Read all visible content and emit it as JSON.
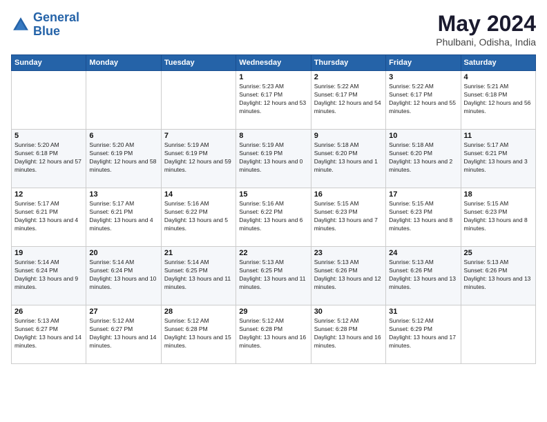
{
  "logo": {
    "line1": "General",
    "line2": "Blue"
  },
  "title": "May 2024",
  "location": "Phulbani, Odisha, India",
  "days_of_week": [
    "Sunday",
    "Monday",
    "Tuesday",
    "Wednesday",
    "Thursday",
    "Friday",
    "Saturday"
  ],
  "weeks": [
    [
      {
        "day": "",
        "sunrise": "",
        "sunset": "",
        "daylight": ""
      },
      {
        "day": "",
        "sunrise": "",
        "sunset": "",
        "daylight": ""
      },
      {
        "day": "",
        "sunrise": "",
        "sunset": "",
        "daylight": ""
      },
      {
        "day": "1",
        "sunrise": "Sunrise: 5:23 AM",
        "sunset": "Sunset: 6:17 PM",
        "daylight": "Daylight: 12 hours and 53 minutes."
      },
      {
        "day": "2",
        "sunrise": "Sunrise: 5:22 AM",
        "sunset": "Sunset: 6:17 PM",
        "daylight": "Daylight: 12 hours and 54 minutes."
      },
      {
        "day": "3",
        "sunrise": "Sunrise: 5:22 AM",
        "sunset": "Sunset: 6:17 PM",
        "daylight": "Daylight: 12 hours and 55 minutes."
      },
      {
        "day": "4",
        "sunrise": "Sunrise: 5:21 AM",
        "sunset": "Sunset: 6:18 PM",
        "daylight": "Daylight: 12 hours and 56 minutes."
      }
    ],
    [
      {
        "day": "5",
        "sunrise": "Sunrise: 5:20 AM",
        "sunset": "Sunset: 6:18 PM",
        "daylight": "Daylight: 12 hours and 57 minutes."
      },
      {
        "day": "6",
        "sunrise": "Sunrise: 5:20 AM",
        "sunset": "Sunset: 6:19 PM",
        "daylight": "Daylight: 12 hours and 58 minutes."
      },
      {
        "day": "7",
        "sunrise": "Sunrise: 5:19 AM",
        "sunset": "Sunset: 6:19 PM",
        "daylight": "Daylight: 12 hours and 59 minutes."
      },
      {
        "day": "8",
        "sunrise": "Sunrise: 5:19 AM",
        "sunset": "Sunset: 6:19 PM",
        "daylight": "Daylight: 13 hours and 0 minutes."
      },
      {
        "day": "9",
        "sunrise": "Sunrise: 5:18 AM",
        "sunset": "Sunset: 6:20 PM",
        "daylight": "Daylight: 13 hours and 1 minute."
      },
      {
        "day": "10",
        "sunrise": "Sunrise: 5:18 AM",
        "sunset": "Sunset: 6:20 PM",
        "daylight": "Daylight: 13 hours and 2 minutes."
      },
      {
        "day": "11",
        "sunrise": "Sunrise: 5:17 AM",
        "sunset": "Sunset: 6:21 PM",
        "daylight": "Daylight: 13 hours and 3 minutes."
      }
    ],
    [
      {
        "day": "12",
        "sunrise": "Sunrise: 5:17 AM",
        "sunset": "Sunset: 6:21 PM",
        "daylight": "Daylight: 13 hours and 4 minutes."
      },
      {
        "day": "13",
        "sunrise": "Sunrise: 5:17 AM",
        "sunset": "Sunset: 6:21 PM",
        "daylight": "Daylight: 13 hours and 4 minutes."
      },
      {
        "day": "14",
        "sunrise": "Sunrise: 5:16 AM",
        "sunset": "Sunset: 6:22 PM",
        "daylight": "Daylight: 13 hours and 5 minutes."
      },
      {
        "day": "15",
        "sunrise": "Sunrise: 5:16 AM",
        "sunset": "Sunset: 6:22 PM",
        "daylight": "Daylight: 13 hours and 6 minutes."
      },
      {
        "day": "16",
        "sunrise": "Sunrise: 5:15 AM",
        "sunset": "Sunset: 6:23 PM",
        "daylight": "Daylight: 13 hours and 7 minutes."
      },
      {
        "day": "17",
        "sunrise": "Sunrise: 5:15 AM",
        "sunset": "Sunset: 6:23 PM",
        "daylight": "Daylight: 13 hours and 8 minutes."
      },
      {
        "day": "18",
        "sunrise": "Sunrise: 5:15 AM",
        "sunset": "Sunset: 6:23 PM",
        "daylight": "Daylight: 13 hours and 8 minutes."
      }
    ],
    [
      {
        "day": "19",
        "sunrise": "Sunrise: 5:14 AM",
        "sunset": "Sunset: 6:24 PM",
        "daylight": "Daylight: 13 hours and 9 minutes."
      },
      {
        "day": "20",
        "sunrise": "Sunrise: 5:14 AM",
        "sunset": "Sunset: 6:24 PM",
        "daylight": "Daylight: 13 hours and 10 minutes."
      },
      {
        "day": "21",
        "sunrise": "Sunrise: 5:14 AM",
        "sunset": "Sunset: 6:25 PM",
        "daylight": "Daylight: 13 hours and 11 minutes."
      },
      {
        "day": "22",
        "sunrise": "Sunrise: 5:13 AM",
        "sunset": "Sunset: 6:25 PM",
        "daylight": "Daylight: 13 hours and 11 minutes."
      },
      {
        "day": "23",
        "sunrise": "Sunrise: 5:13 AM",
        "sunset": "Sunset: 6:26 PM",
        "daylight": "Daylight: 13 hours and 12 minutes."
      },
      {
        "day": "24",
        "sunrise": "Sunrise: 5:13 AM",
        "sunset": "Sunset: 6:26 PM",
        "daylight": "Daylight: 13 hours and 13 minutes."
      },
      {
        "day": "25",
        "sunrise": "Sunrise: 5:13 AM",
        "sunset": "Sunset: 6:26 PM",
        "daylight": "Daylight: 13 hours and 13 minutes."
      }
    ],
    [
      {
        "day": "26",
        "sunrise": "Sunrise: 5:13 AM",
        "sunset": "Sunset: 6:27 PM",
        "daylight": "Daylight: 13 hours and 14 minutes."
      },
      {
        "day": "27",
        "sunrise": "Sunrise: 5:12 AM",
        "sunset": "Sunset: 6:27 PM",
        "daylight": "Daylight: 13 hours and 14 minutes."
      },
      {
        "day": "28",
        "sunrise": "Sunrise: 5:12 AM",
        "sunset": "Sunset: 6:28 PM",
        "daylight": "Daylight: 13 hours and 15 minutes."
      },
      {
        "day": "29",
        "sunrise": "Sunrise: 5:12 AM",
        "sunset": "Sunset: 6:28 PM",
        "daylight": "Daylight: 13 hours and 16 minutes."
      },
      {
        "day": "30",
        "sunrise": "Sunrise: 5:12 AM",
        "sunset": "Sunset: 6:28 PM",
        "daylight": "Daylight: 13 hours and 16 minutes."
      },
      {
        "day": "31",
        "sunrise": "Sunrise: 5:12 AM",
        "sunset": "Sunset: 6:29 PM",
        "daylight": "Daylight: 13 hours and 17 minutes."
      },
      {
        "day": "",
        "sunrise": "",
        "sunset": "",
        "daylight": ""
      }
    ]
  ]
}
